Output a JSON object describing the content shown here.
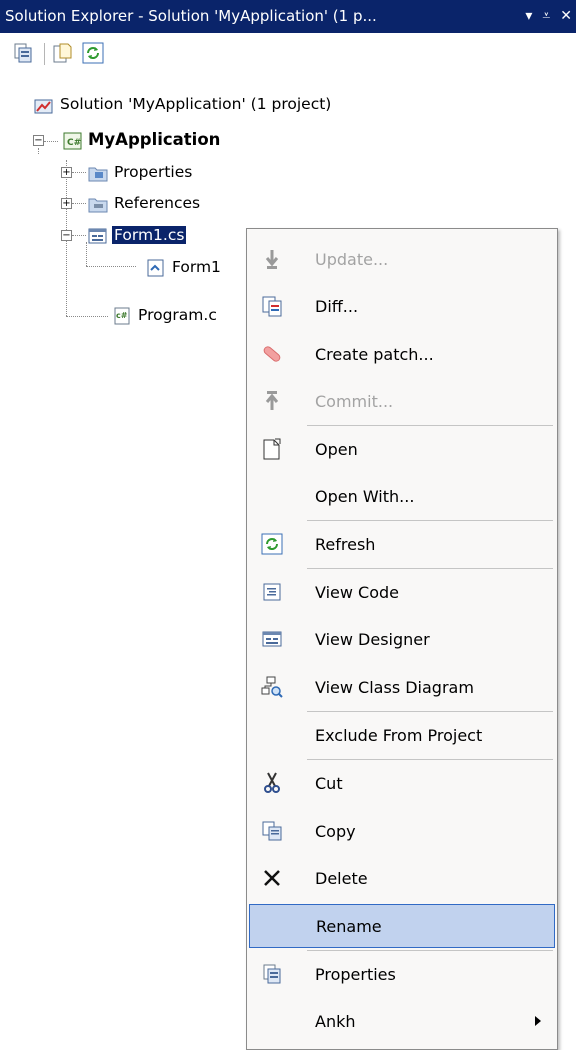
{
  "title": {
    "text": "Solution Explorer - Solution 'MyApplication' (1 p...",
    "pin_glyph": "▾",
    "dock_glyph": "⩡",
    "close_glyph": "✕"
  },
  "toolbar": {
    "buttons": [
      {
        "icon": "properties-icon"
      },
      {
        "icon": "show-all-files-icon"
      },
      {
        "icon": "refresh-icon"
      }
    ]
  },
  "tree": {
    "solution": "Solution 'MyApplication' (1 project)",
    "project": "MyApplication",
    "properties": "Properties",
    "references": "References",
    "form": "Form1.cs",
    "form_child": "Form1",
    "program": "Program.c"
  },
  "menu": {
    "items": [
      {
        "label": "Update...",
        "icon": "update-icon",
        "disabled": true
      },
      {
        "label": "Diff...",
        "icon": "diff-icon",
        "disabled": false
      },
      {
        "label": "Create patch...",
        "icon": "patch-icon",
        "disabled": false
      },
      {
        "label": "Commit...",
        "icon": "commit-icon",
        "disabled": true
      },
      {
        "label": "Open",
        "icon": "open-icon",
        "disabled": false
      },
      {
        "label": "Open With...",
        "icon": "",
        "disabled": false
      },
      {
        "label": "Refresh",
        "icon": "refresh-icon",
        "disabled": false
      },
      {
        "label": "View Code",
        "icon": "view-code-icon",
        "disabled": false
      },
      {
        "label": "View Designer",
        "icon": "view-designer-icon",
        "disabled": false
      },
      {
        "label": "View Class Diagram",
        "icon": "class-diagram-icon",
        "disabled": false
      },
      {
        "label": "Exclude From Project",
        "icon": "",
        "disabled": false
      },
      {
        "label": "Cut",
        "icon": "cut-icon",
        "disabled": false
      },
      {
        "label": "Copy",
        "icon": "copy-icon",
        "disabled": false
      },
      {
        "label": "Delete",
        "icon": "delete-icon",
        "disabled": false
      },
      {
        "label": "Rename",
        "icon": "",
        "disabled": false,
        "highlighted": true
      },
      {
        "label": "Properties",
        "icon": "properties-icon",
        "disabled": false
      },
      {
        "label": "Ankh",
        "icon": "",
        "disabled": false,
        "submenu": true
      }
    ]
  },
  "colors": {
    "title_bg": "#0a246a",
    "selection_bg": "#0a246a",
    "menu_highlight": "#c1d2ee",
    "menu_highlight_border": "#316ac5",
    "disabled_text": "#a3a3a3"
  }
}
